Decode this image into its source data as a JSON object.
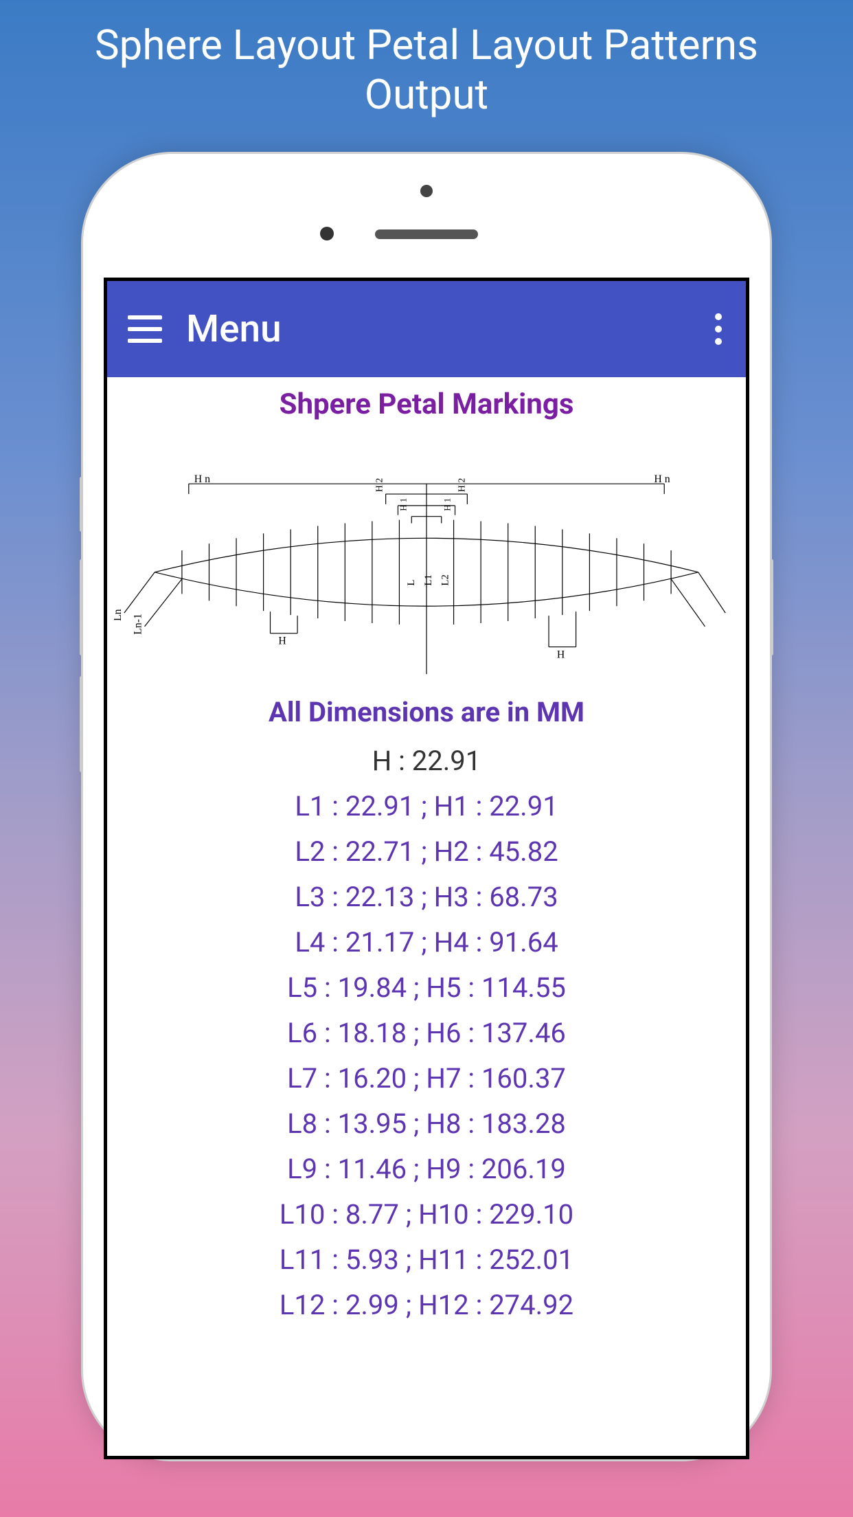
{
  "promo": {
    "title": "Sphere Layout Petal Layout Patterns Output"
  },
  "app_bar": {
    "title": "Menu"
  },
  "content": {
    "title": "Shpere Petal Markings",
    "dimensions_title": "All Dimensions are in MM",
    "h_value": "H : 22.91",
    "rows": [
      "L1 : 22.91 ; H1 : 22.91",
      "L2 : 22.71 ; H2 : 45.82",
      "L3 : 22.13 ; H3 : 68.73",
      "L4 : 21.17 ; H4 : 91.64",
      "L5 : 19.84 ; H5 : 114.55",
      "L6 : 18.18 ; H6 : 137.46",
      "L7 : 16.20 ; H7 : 160.37",
      "L8 : 13.95 ; H8 : 183.28",
      "L9 : 11.46 ; H9 : 206.19",
      "L10 : 8.77 ; H10 : 229.10",
      "L11 : 5.93 ; H11 : 252.01",
      "L12 : 2.99 ; H12 : 274.92"
    ]
  },
  "diagram_labels": {
    "ln_left": "Ln",
    "ln1_left": "Ln-1",
    "hn_left": "H n",
    "h_left": "H",
    "h2_top": "H 2",
    "h1_top": "H 1",
    "l1_center": "L1",
    "l2_center": "L2",
    "l_center": "L",
    "hn_right": "H n",
    "h_right": "H"
  }
}
